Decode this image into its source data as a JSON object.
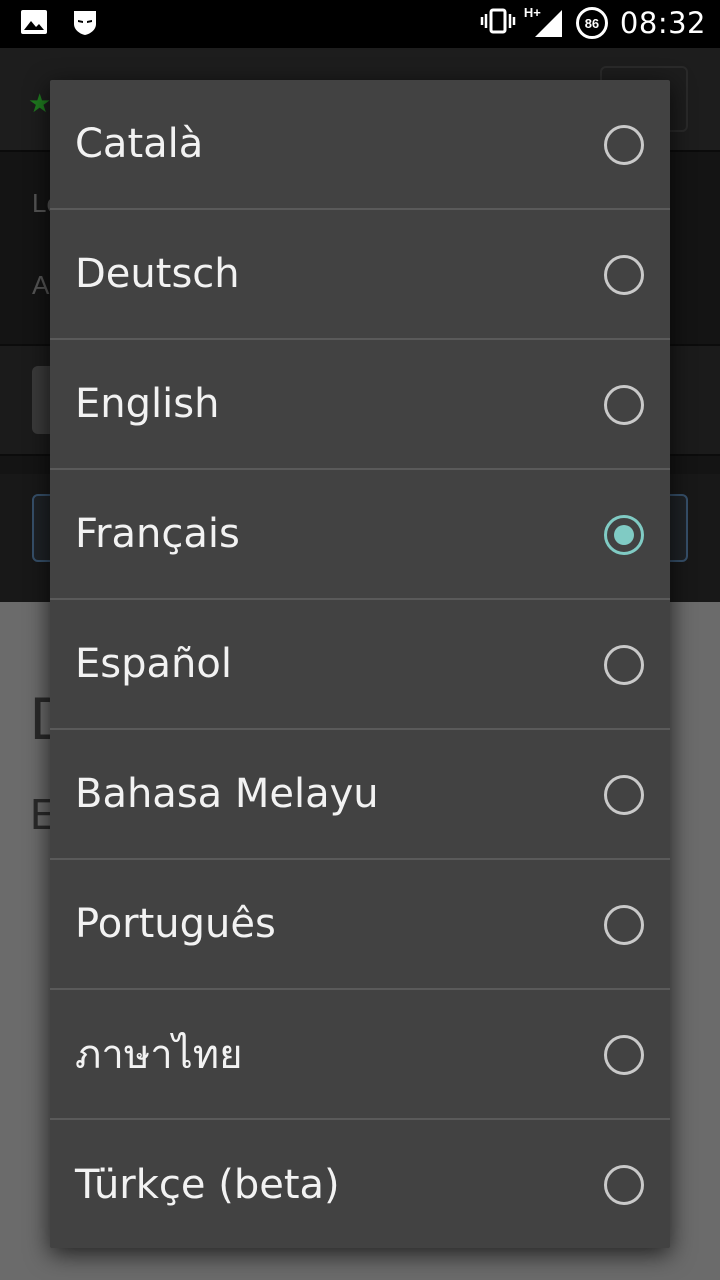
{
  "status_bar": {
    "time": "08:32",
    "battery_level": "86",
    "network_label": "H+",
    "left_icons": [
      "image-icon",
      "mask-icon"
    ],
    "right_icons": [
      "vibrate-icon",
      "signal-icon",
      "battery-circle-icon"
    ]
  },
  "dialog": {
    "accent_color": "#80cbc4",
    "selected_index": 3,
    "options": [
      {
        "label": "Català",
        "checked": false
      },
      {
        "label": "Deutsch",
        "checked": false
      },
      {
        "label": "English",
        "checked": false
      },
      {
        "label": "Français",
        "checked": true
      },
      {
        "label": "Español",
        "checked": false
      },
      {
        "label": "Bahasa Melayu",
        "checked": false
      },
      {
        "label": "Português",
        "checked": false
      },
      {
        "label": "ภาษาไทย",
        "checked": false
      },
      {
        "label": "Türkçe (beta)",
        "checked": false
      }
    ]
  },
  "background": {
    "partial_text_1": "Le",
    "partial_text_2": "A",
    "partial_heading": "D",
    "partial_subheading": "E"
  }
}
